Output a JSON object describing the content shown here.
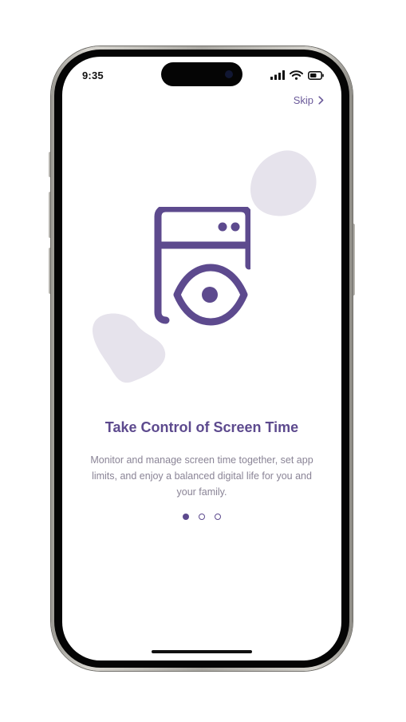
{
  "status_bar": {
    "time": "9:35",
    "icons": [
      "cellular-signal-icon",
      "wifi-icon",
      "battery-icon"
    ]
  },
  "header": {
    "skip_label": "Skip",
    "skip_icon": "chevron-right-icon"
  },
  "onboarding": {
    "illustration_icon": "window-eye-icon",
    "title": "Take Control of Screen Time",
    "description": "Monitor and manage screen time together, set app limits, and enjoy a balanced digital life for you and your family.",
    "page_indicator": {
      "total_pages": 3,
      "current_page": 1
    }
  },
  "colors": {
    "accent": "#5d4a8e",
    "description_text": "#8a8496",
    "blob": "#e6e3ec",
    "background": "#ffffff"
  }
}
